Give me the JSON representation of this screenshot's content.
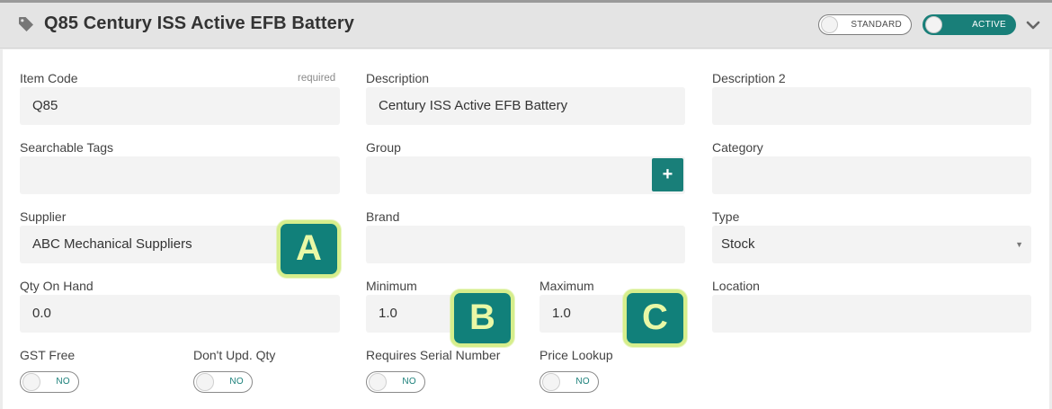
{
  "header": {
    "title": "Q85 Century ISS Active EFB Battery",
    "toggle_standard": "STANDARD",
    "toggle_active": "ACTIVE",
    "accent_color": "#197f79"
  },
  "form": {
    "item_code": {
      "label": "Item Code",
      "required": "required",
      "value": "Q85"
    },
    "description": {
      "label": "Description",
      "value": "Century ISS Active EFB Battery"
    },
    "description2": {
      "label": "Description 2",
      "value": ""
    },
    "searchable_tags": {
      "label": "Searchable Tags",
      "value": ""
    },
    "group": {
      "label": "Group",
      "value": "",
      "add_label": "+"
    },
    "category": {
      "label": "Category",
      "value": ""
    },
    "supplier": {
      "label": "Supplier",
      "value": "ABC Mechanical Suppliers"
    },
    "brand": {
      "label": "Brand",
      "value": ""
    },
    "type": {
      "label": "Type",
      "value": "Stock",
      "caret": "▼"
    },
    "qty_on_hand": {
      "label": "Qty On Hand",
      "value": "0.0"
    },
    "minimum": {
      "label": "Minimum",
      "value": "1.0"
    },
    "maximum": {
      "label": "Maximum",
      "value": "1.0"
    },
    "location": {
      "label": "Location",
      "value": ""
    },
    "gst_free": {
      "label": "GST Free",
      "toggle": "NO"
    },
    "dont_upd_qty": {
      "label": "Don't Upd. Qty",
      "toggle": "NO"
    },
    "requires_serial": {
      "label": "Requires Serial Number",
      "toggle": "NO"
    },
    "price_lookup": {
      "label": "Price Lookup",
      "toggle": "NO"
    }
  },
  "badges": {
    "a": "A",
    "b": "B",
    "c": "C"
  }
}
